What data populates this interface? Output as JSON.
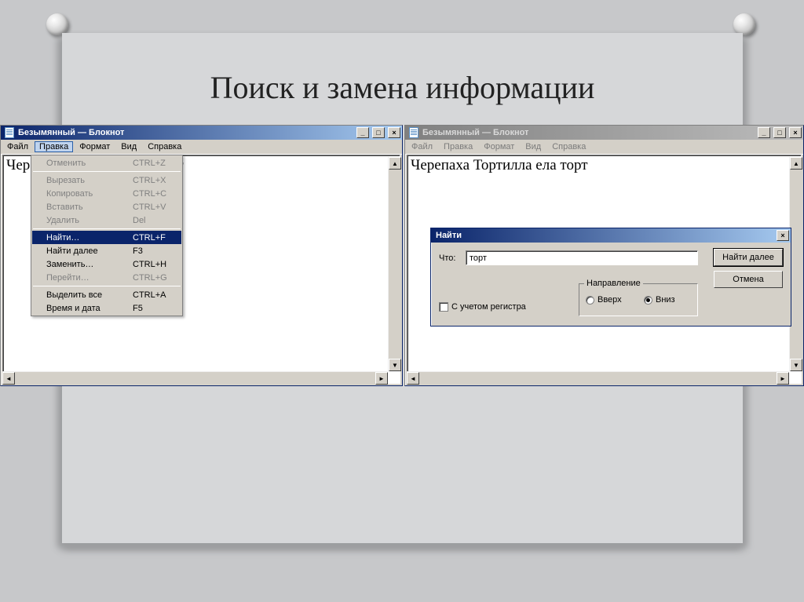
{
  "slide": {
    "title": "Поиск и замена информации"
  },
  "menus": {
    "file": "Файл",
    "edit": "Правка",
    "format": "Формат",
    "view": "Вид",
    "help": "Справка"
  },
  "winbuttons": {
    "min": "_",
    "max": "□",
    "close": "×"
  },
  "notepad_left": {
    "title": "Безымянный — Блокнот",
    "text": "Черепаха Тортилла ела торт"
  },
  "notepad_right": {
    "title": "Безымянный — Блокнот",
    "text": "Черепаха Тортилла ела торт"
  },
  "edit_menu": {
    "items": [
      {
        "label": "Отменить",
        "shortcut": "CTRL+Z",
        "enabled": false
      },
      {
        "label": "Вырезать",
        "shortcut": "CTRL+X",
        "enabled": false
      },
      {
        "label": "Копировать",
        "shortcut": "CTRL+C",
        "enabled": false
      },
      {
        "label": "Вставить",
        "shortcut": "CTRL+V",
        "enabled": false
      },
      {
        "label": "Удалить",
        "shortcut": "Del",
        "enabled": false
      },
      {
        "label": "Найти…",
        "shortcut": "CTRL+F",
        "enabled": true,
        "highlight": true
      },
      {
        "label": "Найти далее",
        "shortcut": "F3",
        "enabled": true
      },
      {
        "label": "Заменить…",
        "shortcut": "CTRL+H",
        "enabled": true
      },
      {
        "label": "Перейти…",
        "shortcut": "CTRL+G",
        "enabled": false
      },
      {
        "label": "Выделить все",
        "shortcut": "CTRL+A",
        "enabled": true
      },
      {
        "label": "Время и дата",
        "shortcut": "F5",
        "enabled": true
      }
    ]
  },
  "find_dialog": {
    "title": "Найти",
    "what_label": "Что:",
    "what_value": "торт",
    "find_next": "Найти далее",
    "cancel": "Отмена",
    "match_case": "С учетом регистра",
    "direction_label": "Направление",
    "up": "Вверх",
    "down": "Вниз"
  }
}
